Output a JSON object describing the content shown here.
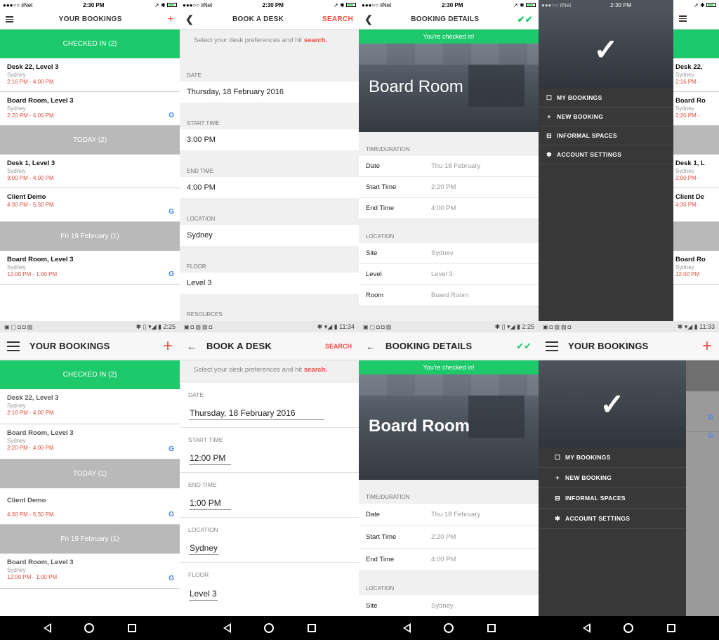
{
  "ios_status": {
    "carrier": "●●●○○ iiNet",
    "time": "2:30 PM"
  },
  "android_status": {
    "time_1": "2:25",
    "time_2": "11:34",
    "time_3": "2:25",
    "time_4": "11:33"
  },
  "bookings": {
    "title": "YOUR BOOKINGS",
    "sections": {
      "checked_in": "CHECKED IN (2)",
      "today_ios": "TODAY (2)",
      "today_android": "TODAY (1)",
      "fri": "Fri 19 February (1)"
    },
    "items": [
      {
        "name": "Desk 22, Level 3",
        "site": "Sydney",
        "time": "2:16 PM - 4:00 PM"
      },
      {
        "name": "Board Room, Level 3",
        "site": "Sydney",
        "time": "2:20 PM - 4:00 PM"
      },
      {
        "name": "Desk 1, Level 3",
        "site": "Sydney",
        "time": "3:00 PM - 4:00 PM"
      },
      {
        "name": "Client Demo",
        "site": "",
        "time": "4:30 PM - 5:30 PM"
      },
      {
        "name": "Board Room, Level 3",
        "site": "Sydney",
        "time": "12:00 PM - 1:00 PM"
      }
    ],
    "google_icon": "G"
  },
  "book_desk": {
    "title_ios": "BOOK A DESK",
    "title_android": "BOOK A DESK",
    "search_label": "SEARCH",
    "hint": "Select your desk preferences and hit",
    "hint_link": "search.",
    "labels": {
      "date": "DATE",
      "start": "START TIME",
      "end": "END TIME",
      "location": "LOCATION",
      "floor": "FLOOR",
      "resources": "RESOURCES"
    },
    "labels_android": {
      "date": "DATE",
      "start": "START TIME",
      "end": "END TIME",
      "location": "LOCATION",
      "floor": "FLOOR"
    },
    "ios_values": {
      "date": "Thursday, 18 February 2016",
      "start": "3:00 PM",
      "end": "4:00 PM",
      "location": "Sydney",
      "floor": "Level 3"
    },
    "android_values": {
      "date": "Thursday, 18 February 2016",
      "start": "12:00 PM",
      "end": "1:00 PM",
      "location": "Sydney",
      "floor": "Level 3"
    }
  },
  "details": {
    "title": "BOOKING DETAILS",
    "checked_in": "You're checked in!",
    "room": "Board Room",
    "sections": {
      "time": "TIME/DURATION",
      "location": "LOCATION"
    },
    "rows": [
      {
        "k": "Date",
        "v": "Thu 18 February"
      },
      {
        "k": "Start Time",
        "v": "2:20 PM"
      },
      {
        "k": "End Time",
        "v": "4:00 PM"
      }
    ],
    "loc_rows": [
      {
        "k": "Site",
        "v": "Sydney"
      },
      {
        "k": "Level",
        "v": "Level 3"
      },
      {
        "k": "Room",
        "v": "Board Room"
      }
    ]
  },
  "menu": {
    "items": [
      "MY BOOKINGS",
      "NEW BOOKING",
      "INFORMAL SPACES",
      "ACCOUNT SETTINGS"
    ]
  },
  "peek": {
    "item1": "Desk 22,",
    "item1s": "Sydney",
    "item1t": "2:16 PM -",
    "item2": "Board Ro",
    "item2s": "Sydney",
    "item2t": "2:20 PM -",
    "item3": "Desk 1, L",
    "item3s": "Sydney",
    "item3t": "3:00 PM -",
    "item4": "Client De",
    "item4t": "4:30 PM -",
    "item5": "Board Ro",
    "item5s": "Sydney",
    "item5t": "12:00 PM"
  },
  "colors": {
    "accent_green": "#1dc96b",
    "accent_red": "#f04b3e",
    "section_grey": "#b9b9b9",
    "menu_dark": "#383838"
  }
}
